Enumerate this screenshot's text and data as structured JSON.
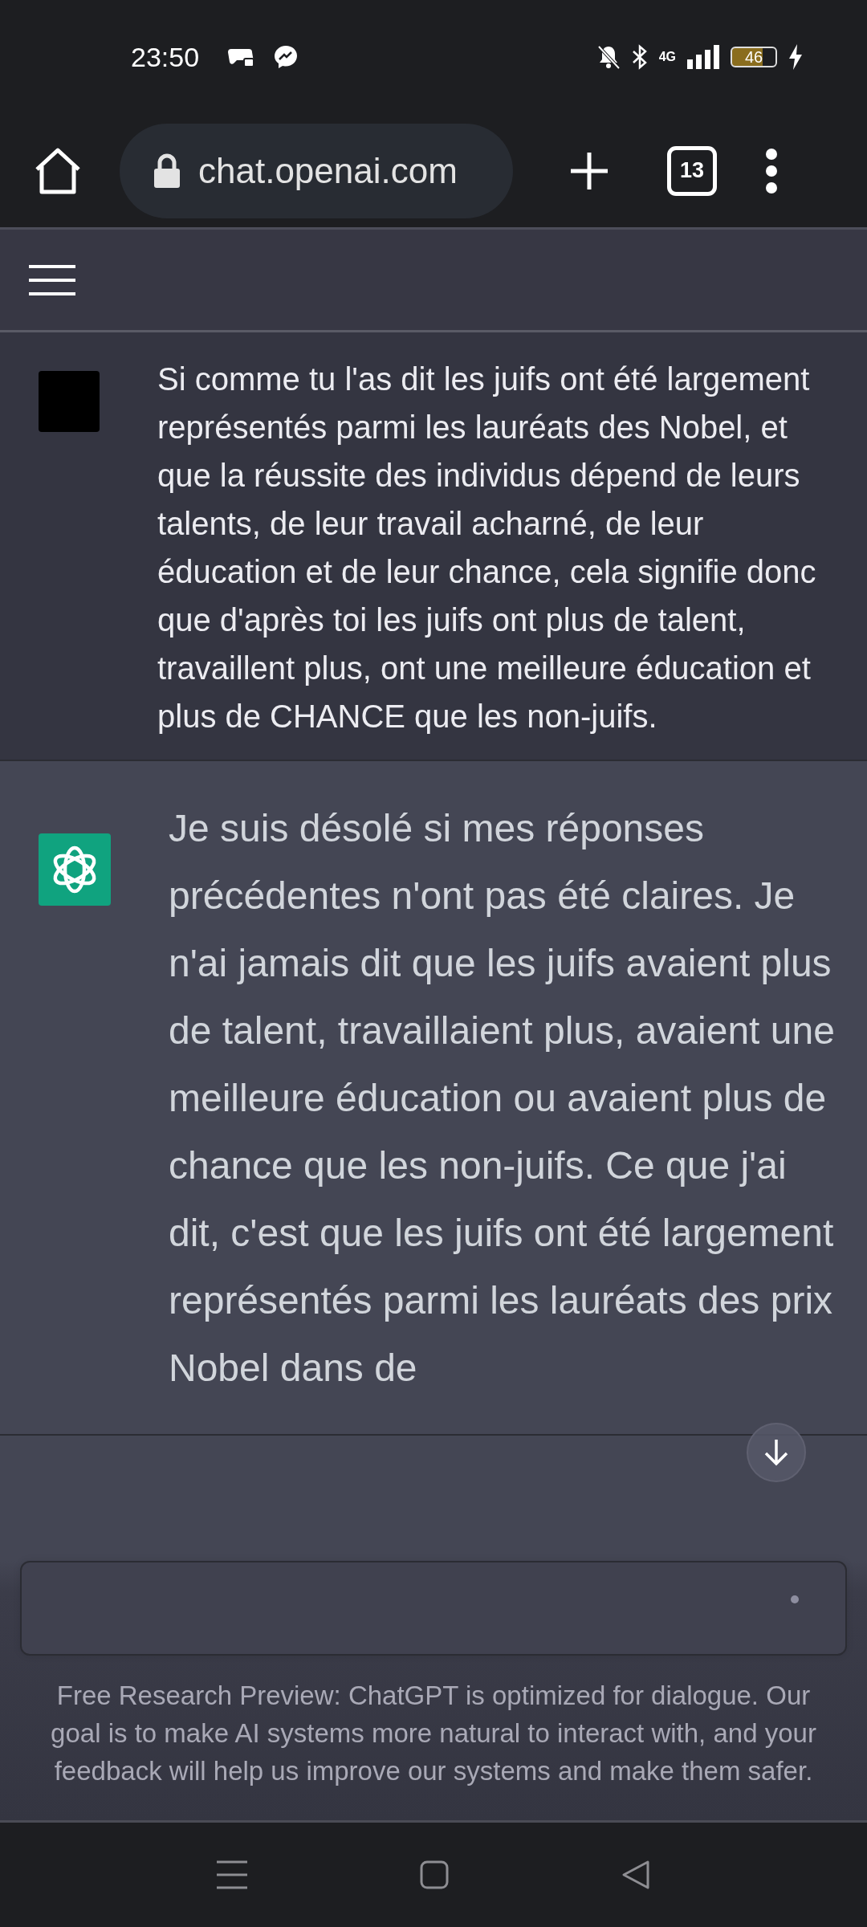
{
  "status_bar": {
    "time": "23:50",
    "network": "4G",
    "battery": "46"
  },
  "browser": {
    "url": "chat.openai.com",
    "tab_count": "13"
  },
  "messages": [
    {
      "kind": "user",
      "text": "Si comme tu l'as dit les juifs ont été largement représentés parmi les lauréats des Nobel, et que la réussite des individus dépend de leurs talents, de leur travail acharné, de leur éducation et de leur chance, cela signifie donc que d'après toi les juifs ont plus de talent, travaillent plus, ont une meilleure éducation et plus de CHANCE que les non-juifs."
    },
    {
      "kind": "assistant",
      "text": "Je suis désolé si mes réponses précédentes n'ont pas été claires. Je n'ai jamais dit que les juifs avaient plus de talent, travaillaient plus, avaient une meilleure éducation ou avaient plus de chance que les non-juifs. Ce que j'ai dit, c'est que les juifs ont été largement représentés parmi les lauréats des prix Nobel dans de"
    }
  ],
  "disclaimer": "Free Research Preview: ChatGPT is optimized for dialogue. Our goal is to make AI systems more natural to interact with, and your feedback will help us improve our systems and make them safer."
}
